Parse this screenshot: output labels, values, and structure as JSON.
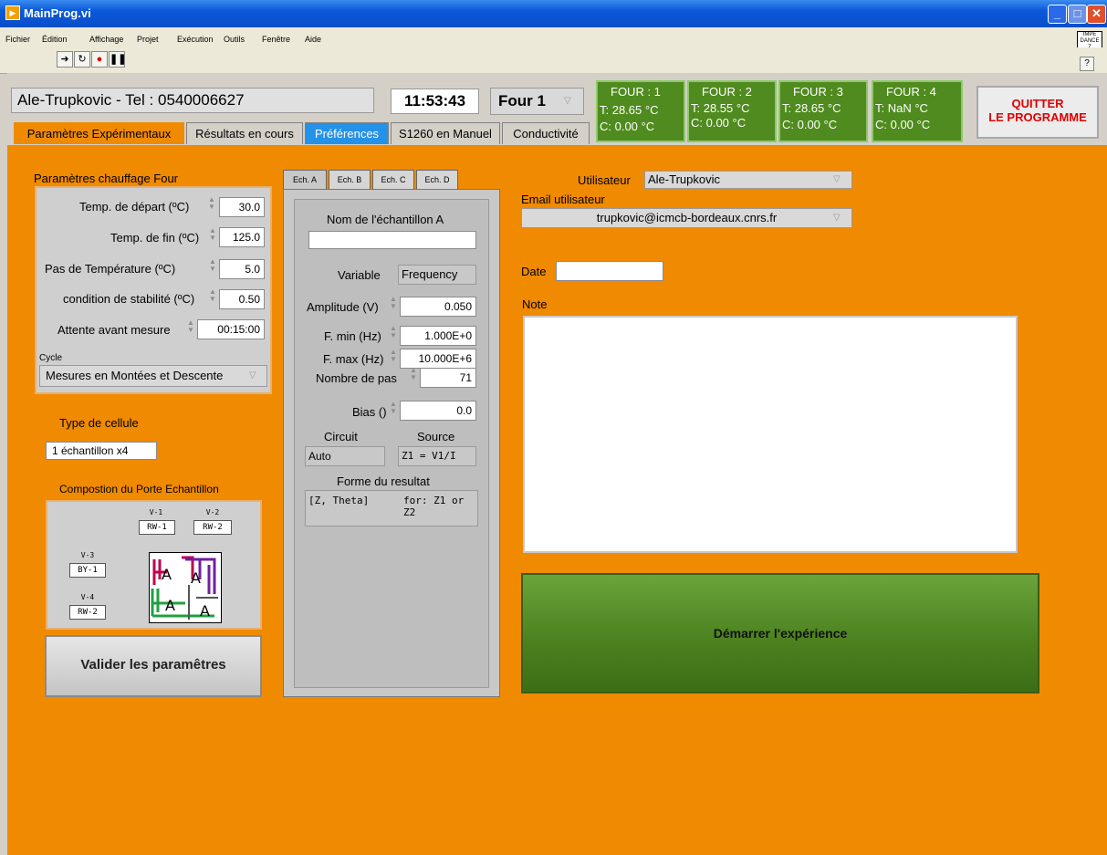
{
  "window": {
    "title": "MainProg.vi"
  },
  "menu": [
    "Fichier",
    "Édition",
    "Affichage",
    "Projet",
    "Exécution",
    "Outils",
    "Fenêtre",
    "Aide"
  ],
  "corner_label": "IMPE DANCE Z",
  "header": {
    "user_display": "Ale-Trupkovic - Tel : 0540006627",
    "time": "11:53:43",
    "four_select": "Four 1",
    "quit_line1": "QUITTER",
    "quit_line2": "LE PROGRAMME"
  },
  "fours": [
    {
      "title": "FOUR : 1",
      "t": "T: 28.65 °C",
      "c": "C: 0.00 °C"
    },
    {
      "title": "FOUR : 2",
      "t": "T: 28.55 °C",
      "c": "C: 0.00 °C"
    },
    {
      "title": "FOUR : 3",
      "t": "T: 28.65 °C",
      "c": "C: 0.00 °C"
    },
    {
      "title": "FOUR : 4",
      "t": "T: NaN °C",
      "c": "C: 0.00 °C"
    }
  ],
  "tabs": [
    "Paramètres Expérimentaux",
    "Résultats en cours",
    "Préférences",
    "S1260 en Manuel",
    "Conductivité"
  ],
  "chauffage": {
    "title": "Paramètres chauffage Four",
    "rows": [
      {
        "label": "Temp. de départ (ºC)",
        "value": "30.0"
      },
      {
        "label": "Temp. de fin (ºC)",
        "value": "125.0"
      },
      {
        "label": "Pas de Température (ºC)",
        "value": "5.0"
      },
      {
        "label": "condition de stabilité (ºC)",
        "value": "0.50"
      },
      {
        "label": "Attente avant mesure",
        "value": "00:15:00"
      }
    ],
    "cycle_label": "Cycle",
    "cycle_value": "Mesures en Montées et Descente"
  },
  "cellule": {
    "title": "Type de cellule",
    "value": "1 échantillon x4"
  },
  "porte": {
    "title": "Compostion du Porte Echantillon",
    "v1": "V-1",
    "rw1": "RW-1",
    "v2": "V-2",
    "rw2": "RW-2",
    "v3": "V-3",
    "by1": "BY-1",
    "v4": "V-4",
    "rw2b": "RW-2"
  },
  "valider": "Valider les paramêtres",
  "ech": {
    "tabs": [
      "Ech. A",
      "Ech. B",
      "Ech. C",
      "Ech. D"
    ],
    "nom_label": "Nom de l'échantillon A",
    "nom_value": "",
    "variable_label": "Variable",
    "variable_value": "Frequency",
    "amplitude_label": "Amplitude (V)",
    "amplitude": "0.050",
    "fmin_label": "F. min (Hz)",
    "fmin": "1.000E+0",
    "fmax_label": "F. max (Hz)",
    "fmax": "10.000E+6",
    "pas_label": "Nombre de pas",
    "pas": "71",
    "bias_label": "Bias ()",
    "bias": "0.0",
    "circuit_label": "Circuit",
    "circuit": "Auto",
    "source_label": "Source",
    "source": "Z1 = V1/I",
    "forme_label": "Forme du resultat",
    "forme": "[Z, Theta]",
    "forme_note": "for: Z1 or Z2"
  },
  "user": {
    "label": "Utilisateur",
    "value": "Ale-Trupkovic",
    "email_label": "Email utilisateur",
    "email": "trupkovic@icmcb-bordeaux.cnrs.fr",
    "date_label": "Date",
    "date": "",
    "note_label": "Note",
    "note": ""
  },
  "start_button": "Démarrer l'expérience"
}
